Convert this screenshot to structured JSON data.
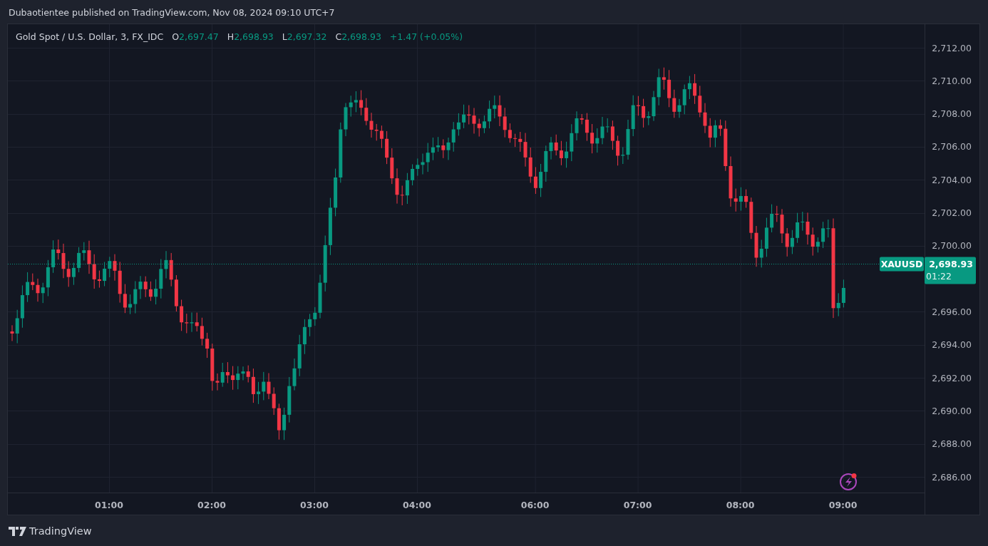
{
  "header": {
    "text": "Dubaotientee published on TradingView.com, Nov 08, 2024 09:10 UTC+7"
  },
  "legend": {
    "symbol": "Gold Spot / U.S. Dollar, 3, FX_IDC",
    "values": [
      {
        "key": "O",
        "value": "2,697.47"
      },
      {
        "key": "H",
        "value": "2,698.93"
      },
      {
        "key": "L",
        "value": "2,697.32"
      },
      {
        "key": "C",
        "value": "2,698.93"
      }
    ],
    "change": "+1.47 (+0.05%)"
  },
  "price_axis": {
    "ticks": [
      "2,712.00",
      "2,710.00",
      "2,708.00",
      "2,706.00",
      "2,704.00",
      "2,702.00",
      "2,700.00",
      "2,696.00",
      "2,694.00",
      "2,692.00",
      "2,690.00",
      "2,688.00",
      "2,686.00"
    ]
  },
  "time_axis": {
    "ticks": [
      "01:00",
      "02:00",
      "03:00",
      "04:00",
      "06:00",
      "07:00",
      "08:00",
      "09:00"
    ]
  },
  "last_price": {
    "symbol": "XAUUSD",
    "price": "2,698.93",
    "countdown": "01:22"
  },
  "footer": {
    "logo_text": "TradingView"
  }
}
